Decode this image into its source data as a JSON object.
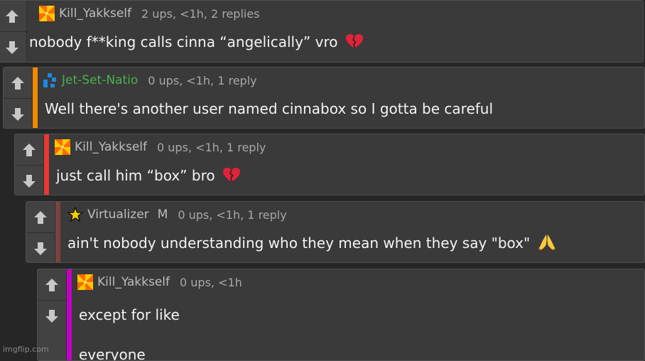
{
  "colors": {
    "bar_level1": "#f08a00",
    "bar_level2": "#e53935",
    "bar_level3": "#7a4141",
    "bar_level4": "#c400c4",
    "username_green": "#4caf50"
  },
  "comments": [
    {
      "username": "Kill_Yakkself",
      "meta": "2 ups, <1h, 2 replies",
      "text": "nobody f**king calls cinna “angelically” vro",
      "emoji": "broken-heart-icon",
      "avatar": "pinwheel-avatar-icon"
    },
    {
      "username": "Jet-Set-Natio",
      "meta": "0 ups, <1h, 1 reply",
      "text": "Well there's another user named cinnabox so I gotta be careful",
      "avatar": "blue-blocks-avatar-icon"
    },
    {
      "username": "Kill_Yakkself",
      "meta": "0 ups, <1h, 1 reply",
      "text": "just call him “box” bro",
      "emoji": "broken-heart-icon",
      "avatar": "pinwheel-avatar-icon"
    },
    {
      "username": "Virtualizer",
      "badge": "M",
      "meta": "0 ups, <1h, 1 reply",
      "text": "ain't nobody understanding who they mean when they say \"box\"",
      "emoji": "praying-hands-icon",
      "avatar": "star-avatar-icon"
    },
    {
      "username": "Kill_Yakkself",
      "meta": "0 ups, <1h",
      "text": "except for like",
      "text2": "everyone",
      "avatar": "pinwheel-avatar-icon"
    }
  ],
  "watermark": "imgflip.com"
}
